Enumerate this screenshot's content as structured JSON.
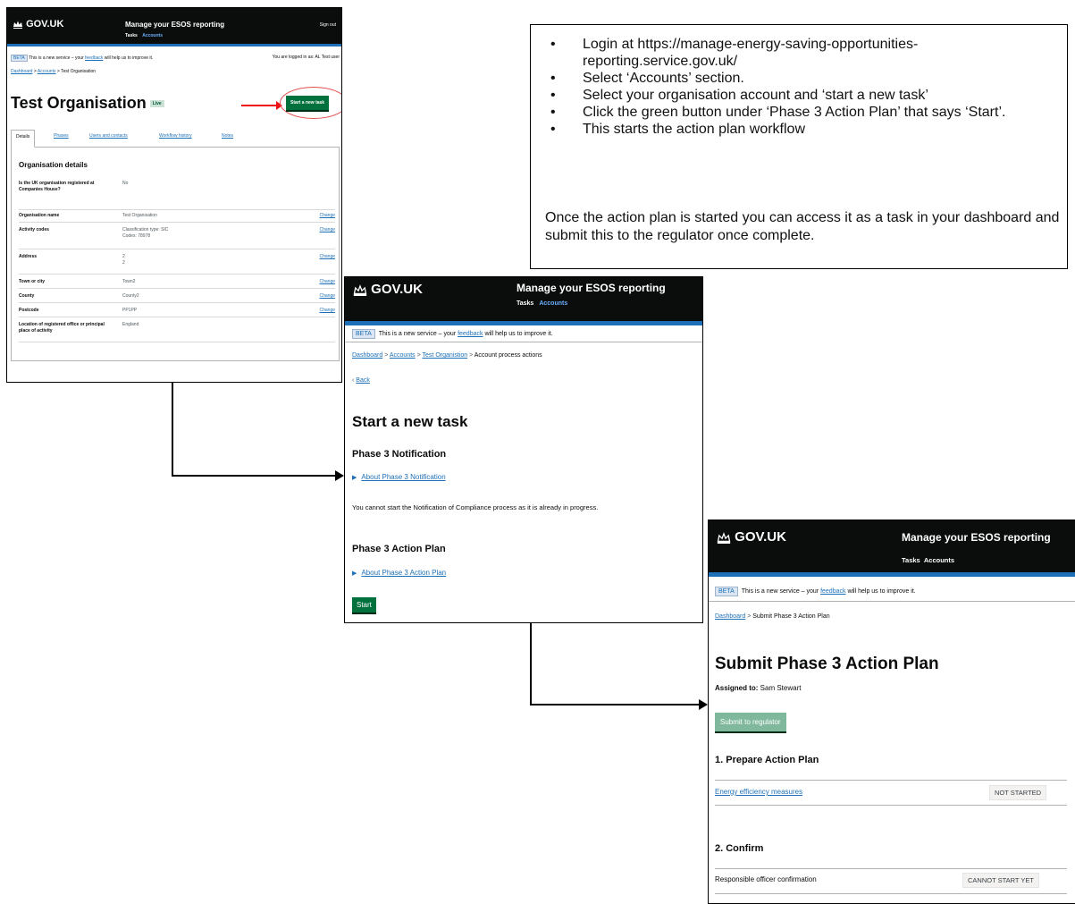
{
  "callout": {
    "bullets": [
      "Login at https://manage-energy-saving-opportunities-reporting.service.gov.uk/",
      "Select ‘Accounts’ section.",
      "Select your organisation account and ‘start a new task’",
      "Click the green button under ‘Phase 3 Action Plan’ that says ‘Start’.",
      "This starts the action plan workflow"
    ],
    "note": "Once the action plan is started you can access it as a task in your dashboard and submit this to the regulator once complete."
  },
  "shot1": {
    "logo": "GOV.UK",
    "service": "Manage your ESOS reporting",
    "nav_tasks": "Tasks",
    "nav_accounts": "Accounts",
    "sign_out": "Sign out",
    "beta": "BETA",
    "beta_text_pre": "This is a new service – your ",
    "beta_link": "feedback",
    "beta_text_post": " will help us to improve it.",
    "logged_in": "You are logged in as: AL Test user",
    "crumb_dashboard": "Dashboard",
    "crumb_accounts": "Accounts",
    "crumb_current": "Test Organisation",
    "title": "Test Organisation",
    "tag": "Live",
    "new_task_button": "Start a new task",
    "tabs": [
      "Details",
      "Phases",
      "Users and contacts",
      "Workflow history",
      "Notes"
    ],
    "panel_title": "Organisation details",
    "rows": [
      {
        "k": "Is the UK organisation registered at Companies House?",
        "v": "No",
        "c": ""
      },
      {
        "k": "Organisation name",
        "v": "Test Organisation",
        "c": "Change"
      },
      {
        "k": "Activity codes",
        "v": "Classification type: SIC",
        "v2": "Codes: 78978",
        "c": "Change"
      },
      {
        "k": "Address",
        "v": "2",
        "v2": "2",
        "c": "Change"
      },
      {
        "k": "Town or city",
        "v": "Town2",
        "c": "Change"
      },
      {
        "k": "County",
        "v": "County2",
        "c": "Change"
      },
      {
        "k": "Postcode",
        "v": "PP1PP",
        "c": "Change"
      },
      {
        "k": "Location of registered office or principal place of activity",
        "v": "England",
        "c": ""
      }
    ]
  },
  "shot2": {
    "logo": "GOV.UK",
    "service": "Manage your ESOS reporting",
    "nav_tasks": "Tasks",
    "nav_accounts": "Accounts",
    "beta": "BETA",
    "beta_text_pre": "This is a new service – your ",
    "beta_link": "feedback",
    "beta_text_post": " will help us to improve it.",
    "crumb_dashboard": "Dashboard",
    "crumb_accounts": "Accounts",
    "crumb_org": "Test Organistion",
    "crumb_current": "Account process actions",
    "back": "Back",
    "title": "Start a new task",
    "h_notification": "Phase 3 Notification",
    "about_notification": "About Phase 3 Notification",
    "notification_msg": "You cannot start the Notification of Compliance process as it is already in progress.",
    "h_action_plan": "Phase 3 Action Plan",
    "about_action_plan": "About Phase 3 Action Plan",
    "start_button": "Start"
  },
  "shot3": {
    "logo": "GOV.UK",
    "service": "Manage your ESOS reporting",
    "nav_tasks": "Tasks",
    "nav_accounts": "Accounts",
    "beta": "BETA",
    "beta_text_pre": "This is a new service – your ",
    "beta_link": "feedback",
    "beta_text_post": " will help us to improve it.",
    "crumb_dashboard": "Dashboard",
    "crumb_current": "Submit Phase 3 Action Plan",
    "title": "Submit Phase 3 Action Plan",
    "assigned_label": "Assigned to:",
    "assigned_name": " Sam Stewart",
    "submit_button": "Submit to regulator",
    "section1": "1. Prepare Action Plan",
    "task1": "Energy efficiency measures",
    "status1": "NOT STARTED",
    "section2": "2. Confirm",
    "task2": "Responsible officer confirmation",
    "status2": "CANNOT START YET"
  },
  "colors": {
    "govuk_black": "#0b0c0c",
    "govuk_blue": "#1d70b8",
    "govuk_green": "#00703c",
    "highlight_red": "#e11111"
  }
}
